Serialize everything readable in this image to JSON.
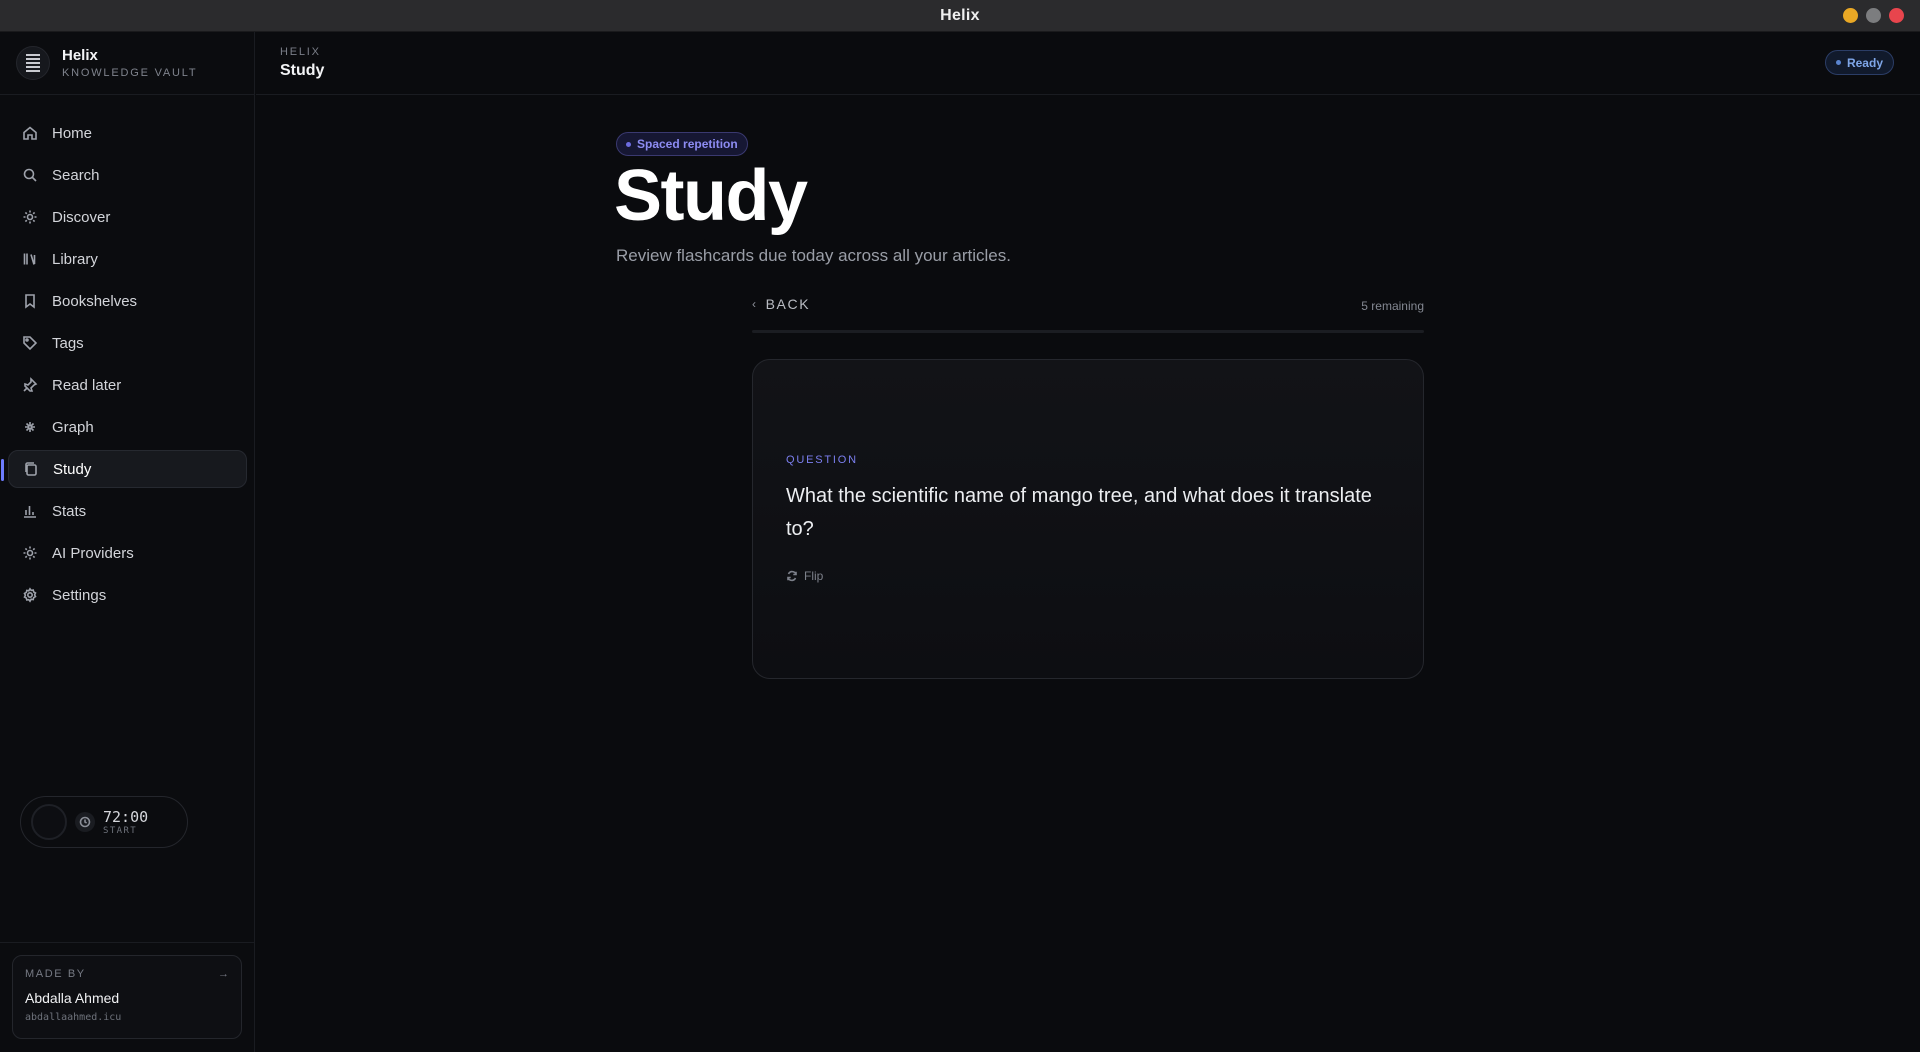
{
  "window": {
    "title": "Helix"
  },
  "brand": {
    "name": "Helix",
    "subtitle": "KNOWLEDGE VAULT"
  },
  "sidebar": {
    "items": [
      {
        "label": "Home",
        "icon": "home-icon"
      },
      {
        "label": "Search",
        "icon": "search-icon"
      },
      {
        "label": "Discover",
        "icon": "sparkle-icon"
      },
      {
        "label": "Library",
        "icon": "library-icon"
      },
      {
        "label": "Bookshelves",
        "icon": "bookmark-icon"
      },
      {
        "label": "Tags",
        "icon": "tag-icon"
      },
      {
        "label": "Read later",
        "icon": "pin-icon"
      },
      {
        "label": "Graph",
        "icon": "graph-icon"
      },
      {
        "label": "Study",
        "icon": "cards-icon",
        "active": true
      },
      {
        "label": "Stats",
        "icon": "bar-chart-icon"
      },
      {
        "label": "AI Providers",
        "icon": "sparkle-icon"
      },
      {
        "label": "Settings",
        "icon": "gear-icon"
      }
    ]
  },
  "timer": {
    "time": "72:00",
    "action": "START"
  },
  "made_by": {
    "label": "MADE BY",
    "arrow": "→",
    "author": "Abdalla Ahmed",
    "site": "abdallaahmed.icu"
  },
  "header": {
    "crumb": "HELIX",
    "page": "Study",
    "status": "Ready"
  },
  "main": {
    "badge": "Spaced repetition",
    "title": "Study",
    "subtitle": "Review flashcards due today across all your articles.",
    "back_label": "BACK",
    "remaining": "5 remaining",
    "progress": 0
  },
  "card": {
    "label": "QUESTION",
    "question": "What the scientific name of mango tree, and what does it translate to?",
    "flip_label": "Flip"
  },
  "colors": {
    "accent": "#6d7cff",
    "status": "#7fa6e8",
    "badge": "#8d8cf2"
  }
}
